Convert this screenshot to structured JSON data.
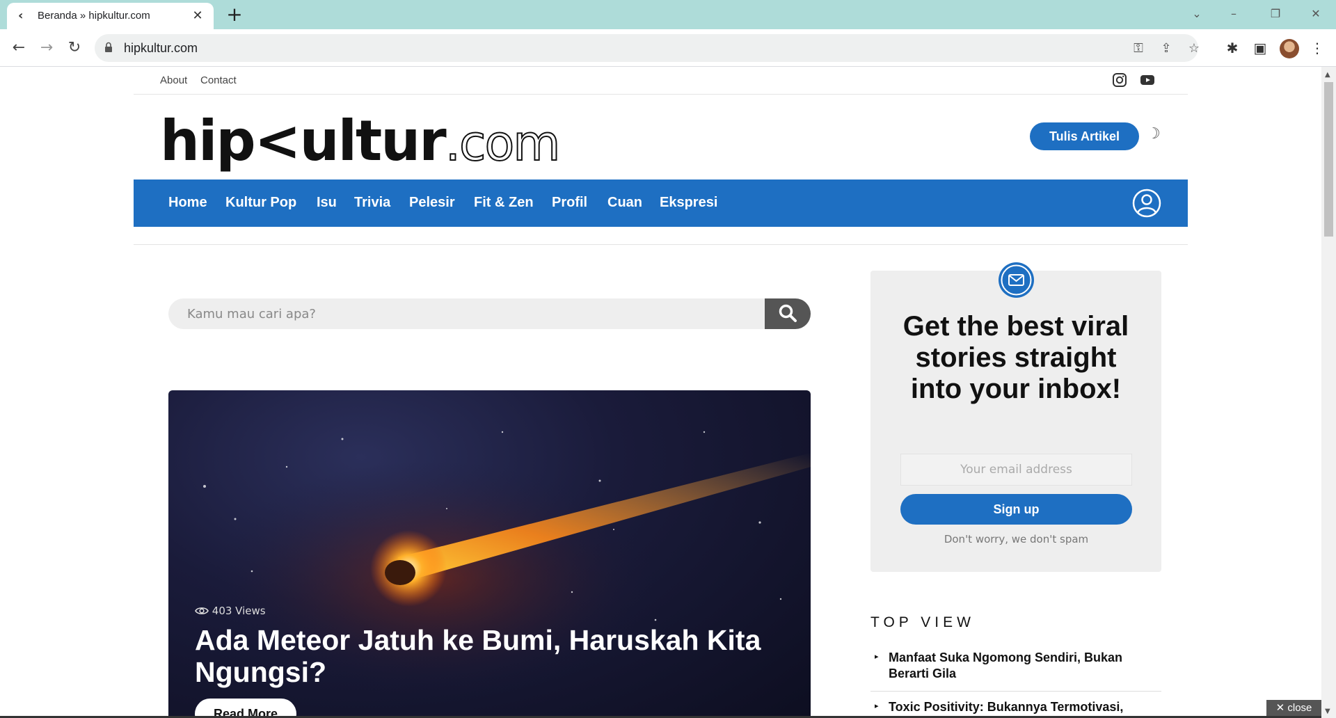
{
  "browser": {
    "tab_title": "Beranda » hipkultur.com",
    "url": "hipkultur.com"
  },
  "site": {
    "top_links": [
      "About",
      "Contact"
    ],
    "logo_main": "hip<ultur",
    "logo_suffix": ".com",
    "write_button": "Tulis Artikel",
    "nav_items": [
      "Home",
      "Kultur Pop",
      "Isu",
      "Trivia",
      "Pelesir",
      "Fit & Zen",
      "Profil",
      "Cuan",
      "Ekspresi"
    ],
    "accent_color": "#1e6fc2"
  },
  "search": {
    "placeholder": "Kamu mau cari apa?"
  },
  "hero": {
    "views": "403 Views",
    "title": "Ada Meteor Jatuh ke Bumi, Haruskah Kita Ngungsi?",
    "read_more": "Read More"
  },
  "newsletter": {
    "headline": "Get the best viral stories straight into your inbox!",
    "email_placeholder": "Your email address",
    "signup_label": "Sign up",
    "note": "Don't worry, we don't spam"
  },
  "top_view": {
    "title": "TOP VIEW",
    "items": [
      "Manfaat Suka Ngomong Sendiri, Bukan Berarti Gila",
      "Toxic Positivity: Bukannya Termotivasi,"
    ]
  },
  "ad": {
    "close_label": "close"
  }
}
